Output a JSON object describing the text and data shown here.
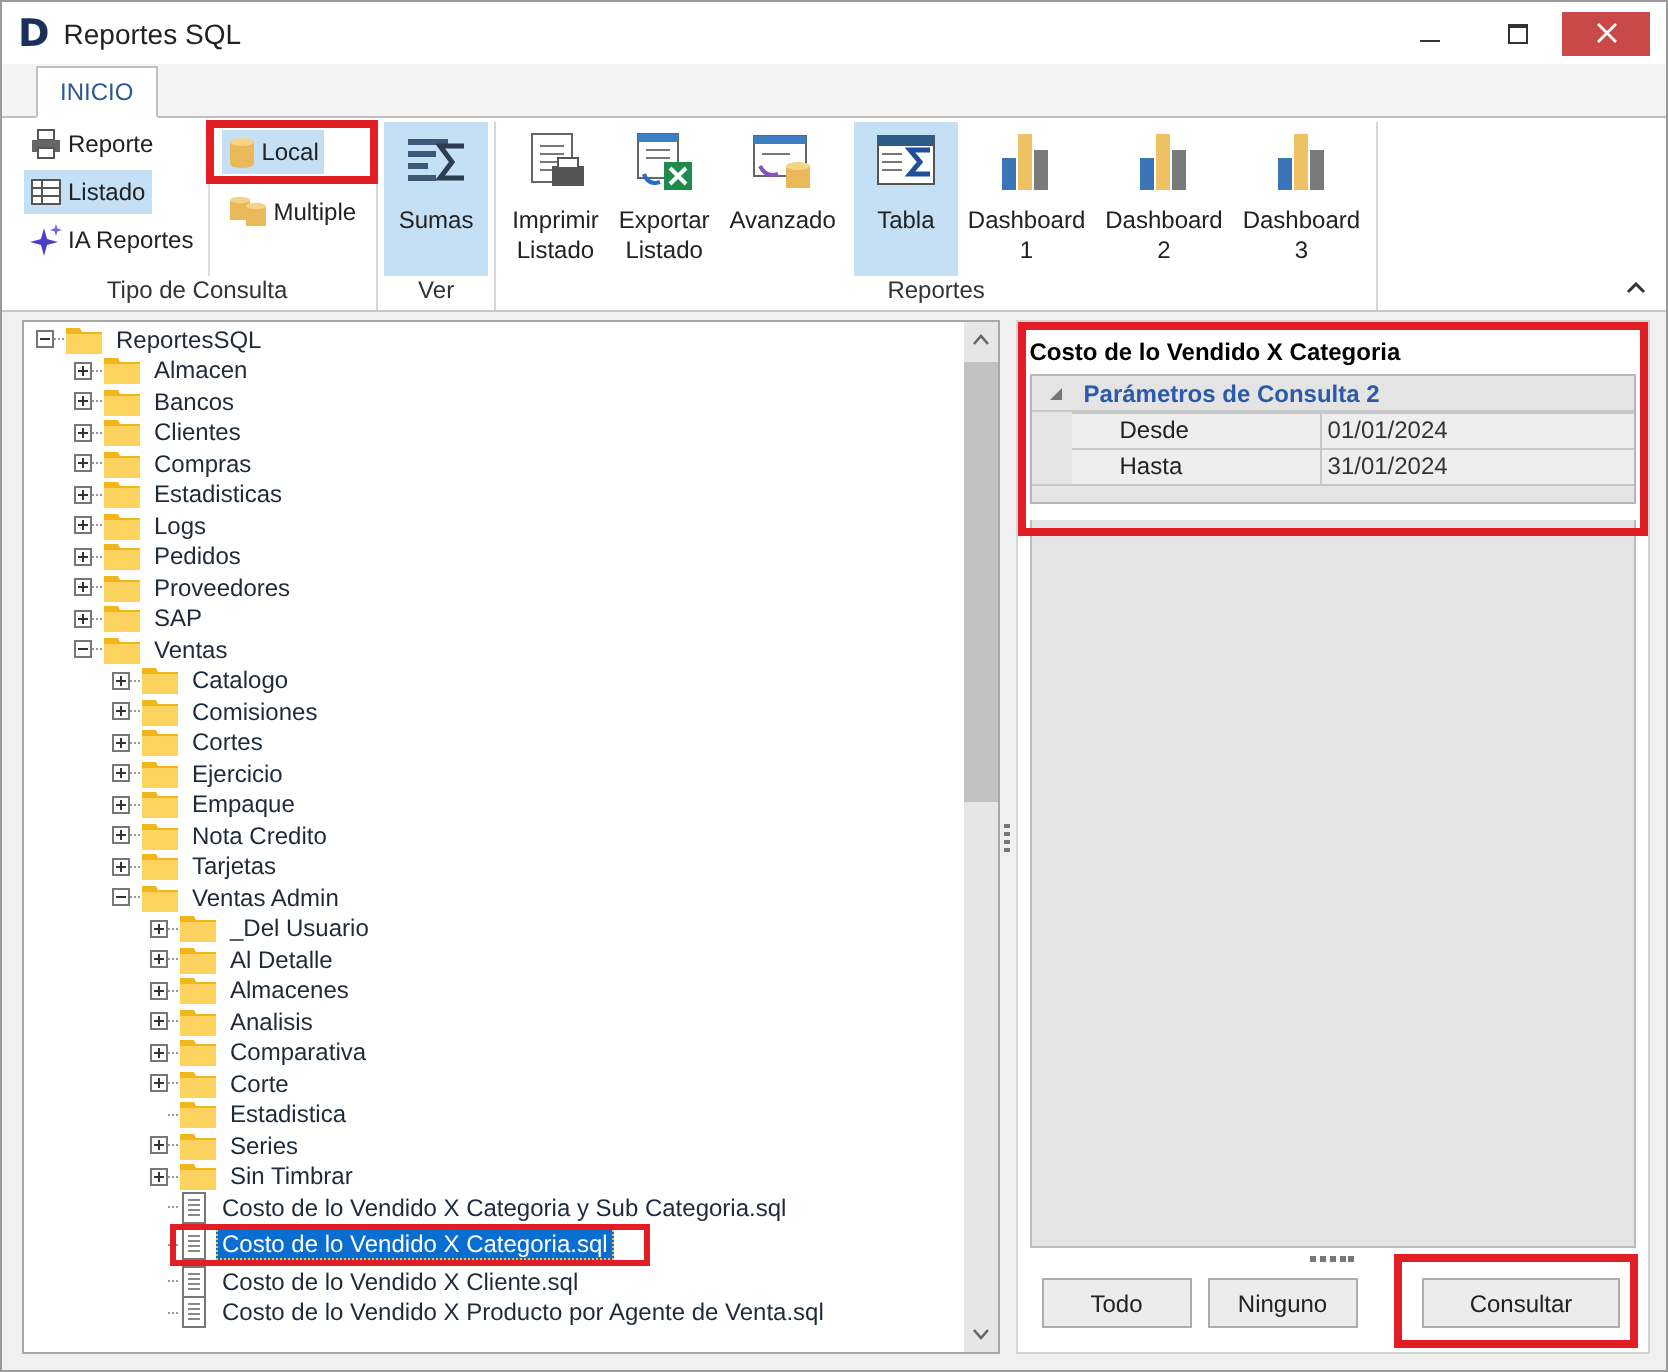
{
  "window": {
    "logo": "D",
    "title": "Reportes SQL"
  },
  "ribbon_tabs": [
    {
      "label": "INICIO",
      "selected": true
    }
  ],
  "ribbon": {
    "groups": [
      {
        "kind": "small",
        "label": "Tipo de Consulta",
        "columns": [
          [
            {
              "label": "Reporte",
              "selected": false,
              "highlighted": false
            },
            {
              "label": "Listado",
              "selected": true,
              "highlighted": false
            },
            {
              "label": "IA Reportes",
              "selected": false,
              "highlighted": false
            }
          ],
          [
            {
              "label": "Local",
              "selected": true,
              "highlighted": true
            },
            {
              "label": "Multiple",
              "selected": false,
              "highlighted": false
            }
          ]
        ]
      },
      {
        "kind": "large",
        "label": "Ver",
        "buttons": [
          {
            "label": "Sumas",
            "selected": true
          }
        ]
      },
      {
        "kind": "large",
        "label": "Reportes",
        "buttons": [
          {
            "label": "Imprimir\nListado",
            "selected": false
          },
          {
            "label": "Exportar\nListado",
            "selected": false
          },
          {
            "label": "Avanzado",
            "selected": false
          },
          {
            "label": "Tabla",
            "selected": true
          },
          {
            "label": "Dashboard\n1",
            "selected": false
          },
          {
            "label": "Dashboard\n2",
            "selected": false
          },
          {
            "label": "Dashboard\n3",
            "selected": false
          }
        ]
      }
    ]
  },
  "tree": [
    {
      "label": "ReportesSQL",
      "kind": "folder",
      "expanded": true,
      "selected": false,
      "children": [
        {
          "label": "Almacen",
          "kind": "folder",
          "expanded": false,
          "selected": false
        },
        {
          "label": "Bancos",
          "kind": "folder",
          "expanded": false,
          "selected": false
        },
        {
          "label": "Clientes",
          "kind": "folder",
          "expanded": false,
          "selected": false
        },
        {
          "label": "Compras",
          "kind": "folder",
          "expanded": false,
          "selected": false
        },
        {
          "label": "Estadisticas",
          "kind": "folder",
          "expanded": false,
          "selected": false
        },
        {
          "label": "Logs",
          "kind": "folder",
          "expanded": false,
          "selected": false
        },
        {
          "label": "Pedidos",
          "kind": "folder",
          "expanded": false,
          "selected": false
        },
        {
          "label": "Proveedores",
          "kind": "folder",
          "expanded": false,
          "selected": false
        },
        {
          "label": "SAP",
          "kind": "folder",
          "expanded": false,
          "selected": false
        },
        {
          "label": "Ventas",
          "kind": "folder",
          "expanded": true,
          "selected": false,
          "children": [
            {
              "label": "Catalogo",
              "kind": "folder",
              "expanded": false,
              "selected": false
            },
            {
              "label": "Comisiones",
              "kind": "folder",
              "expanded": false,
              "selected": false
            },
            {
              "label": "Cortes",
              "kind": "folder",
              "expanded": false,
              "selected": false
            },
            {
              "label": "Ejercicio",
              "kind": "folder",
              "expanded": false,
              "selected": false
            },
            {
              "label": "Empaque",
              "kind": "folder",
              "expanded": false,
              "selected": false
            },
            {
              "label": "Nota Credito",
              "kind": "folder",
              "expanded": false,
              "selected": false
            },
            {
              "label": "Tarjetas",
              "kind": "folder",
              "expanded": false,
              "selected": false
            },
            {
              "label": "Ventas Admin",
              "kind": "folder",
              "expanded": true,
              "selected": false,
              "children": [
                {
                  "label": "_Del Usuario",
                  "kind": "folder",
                  "expanded": false,
                  "selected": false
                },
                {
                  "label": "Al Detalle",
                  "kind": "folder",
                  "expanded": false,
                  "selected": false
                },
                {
                  "label": "Almacenes",
                  "kind": "folder",
                  "expanded": false,
                  "selected": false
                },
                {
                  "label": "Analisis",
                  "kind": "folder",
                  "expanded": false,
                  "selected": false
                },
                {
                  "label": "Comparativa",
                  "kind": "folder",
                  "expanded": false,
                  "selected": false
                },
                {
                  "label": "Corte",
                  "kind": "folder",
                  "expanded": false,
                  "selected": false
                },
                {
                  "label": "Estadistica",
                  "kind": "folder",
                  "selected": false
                },
                {
                  "label": "Series",
                  "kind": "folder",
                  "expanded": false,
                  "selected": false
                },
                {
                  "label": "Sin Timbrar",
                  "kind": "folder",
                  "expanded": false,
                  "selected": false
                },
                {
                  "label": "Costo de lo Vendido X Categoria y Sub Categoria.sql",
                  "kind": "file",
                  "selected": false
                },
                {
                  "label": "Costo de lo Vendido X Categoria.sql",
                  "kind": "file",
                  "selected": true,
                  "highlighted": true
                },
                {
                  "label": "Costo de lo Vendido X Cliente.sql",
                  "kind": "file",
                  "selected": false
                },
                {
                  "label": "Costo de lo Vendido X Producto por Agente de Venta.sql",
                  "kind": "file",
                  "selected": false
                }
              ]
            }
          ]
        }
      ]
    }
  ],
  "properties": {
    "title": "Costo de lo Vendido X Categoria",
    "highlighted": true,
    "category": {
      "label": "Parámetros de Consulta 2",
      "expanded": true
    },
    "rows": [
      {
        "name": "Desde",
        "value": "01/01/2024"
      },
      {
        "name": "Hasta",
        "value": "31/01/2024"
      }
    ]
  },
  "buttons": [
    {
      "label": "Todo",
      "highlighted": false
    },
    {
      "label": "Ninguno",
      "highlighted": false
    },
    {
      "label": "Consultar",
      "highlighted": true
    }
  ]
}
